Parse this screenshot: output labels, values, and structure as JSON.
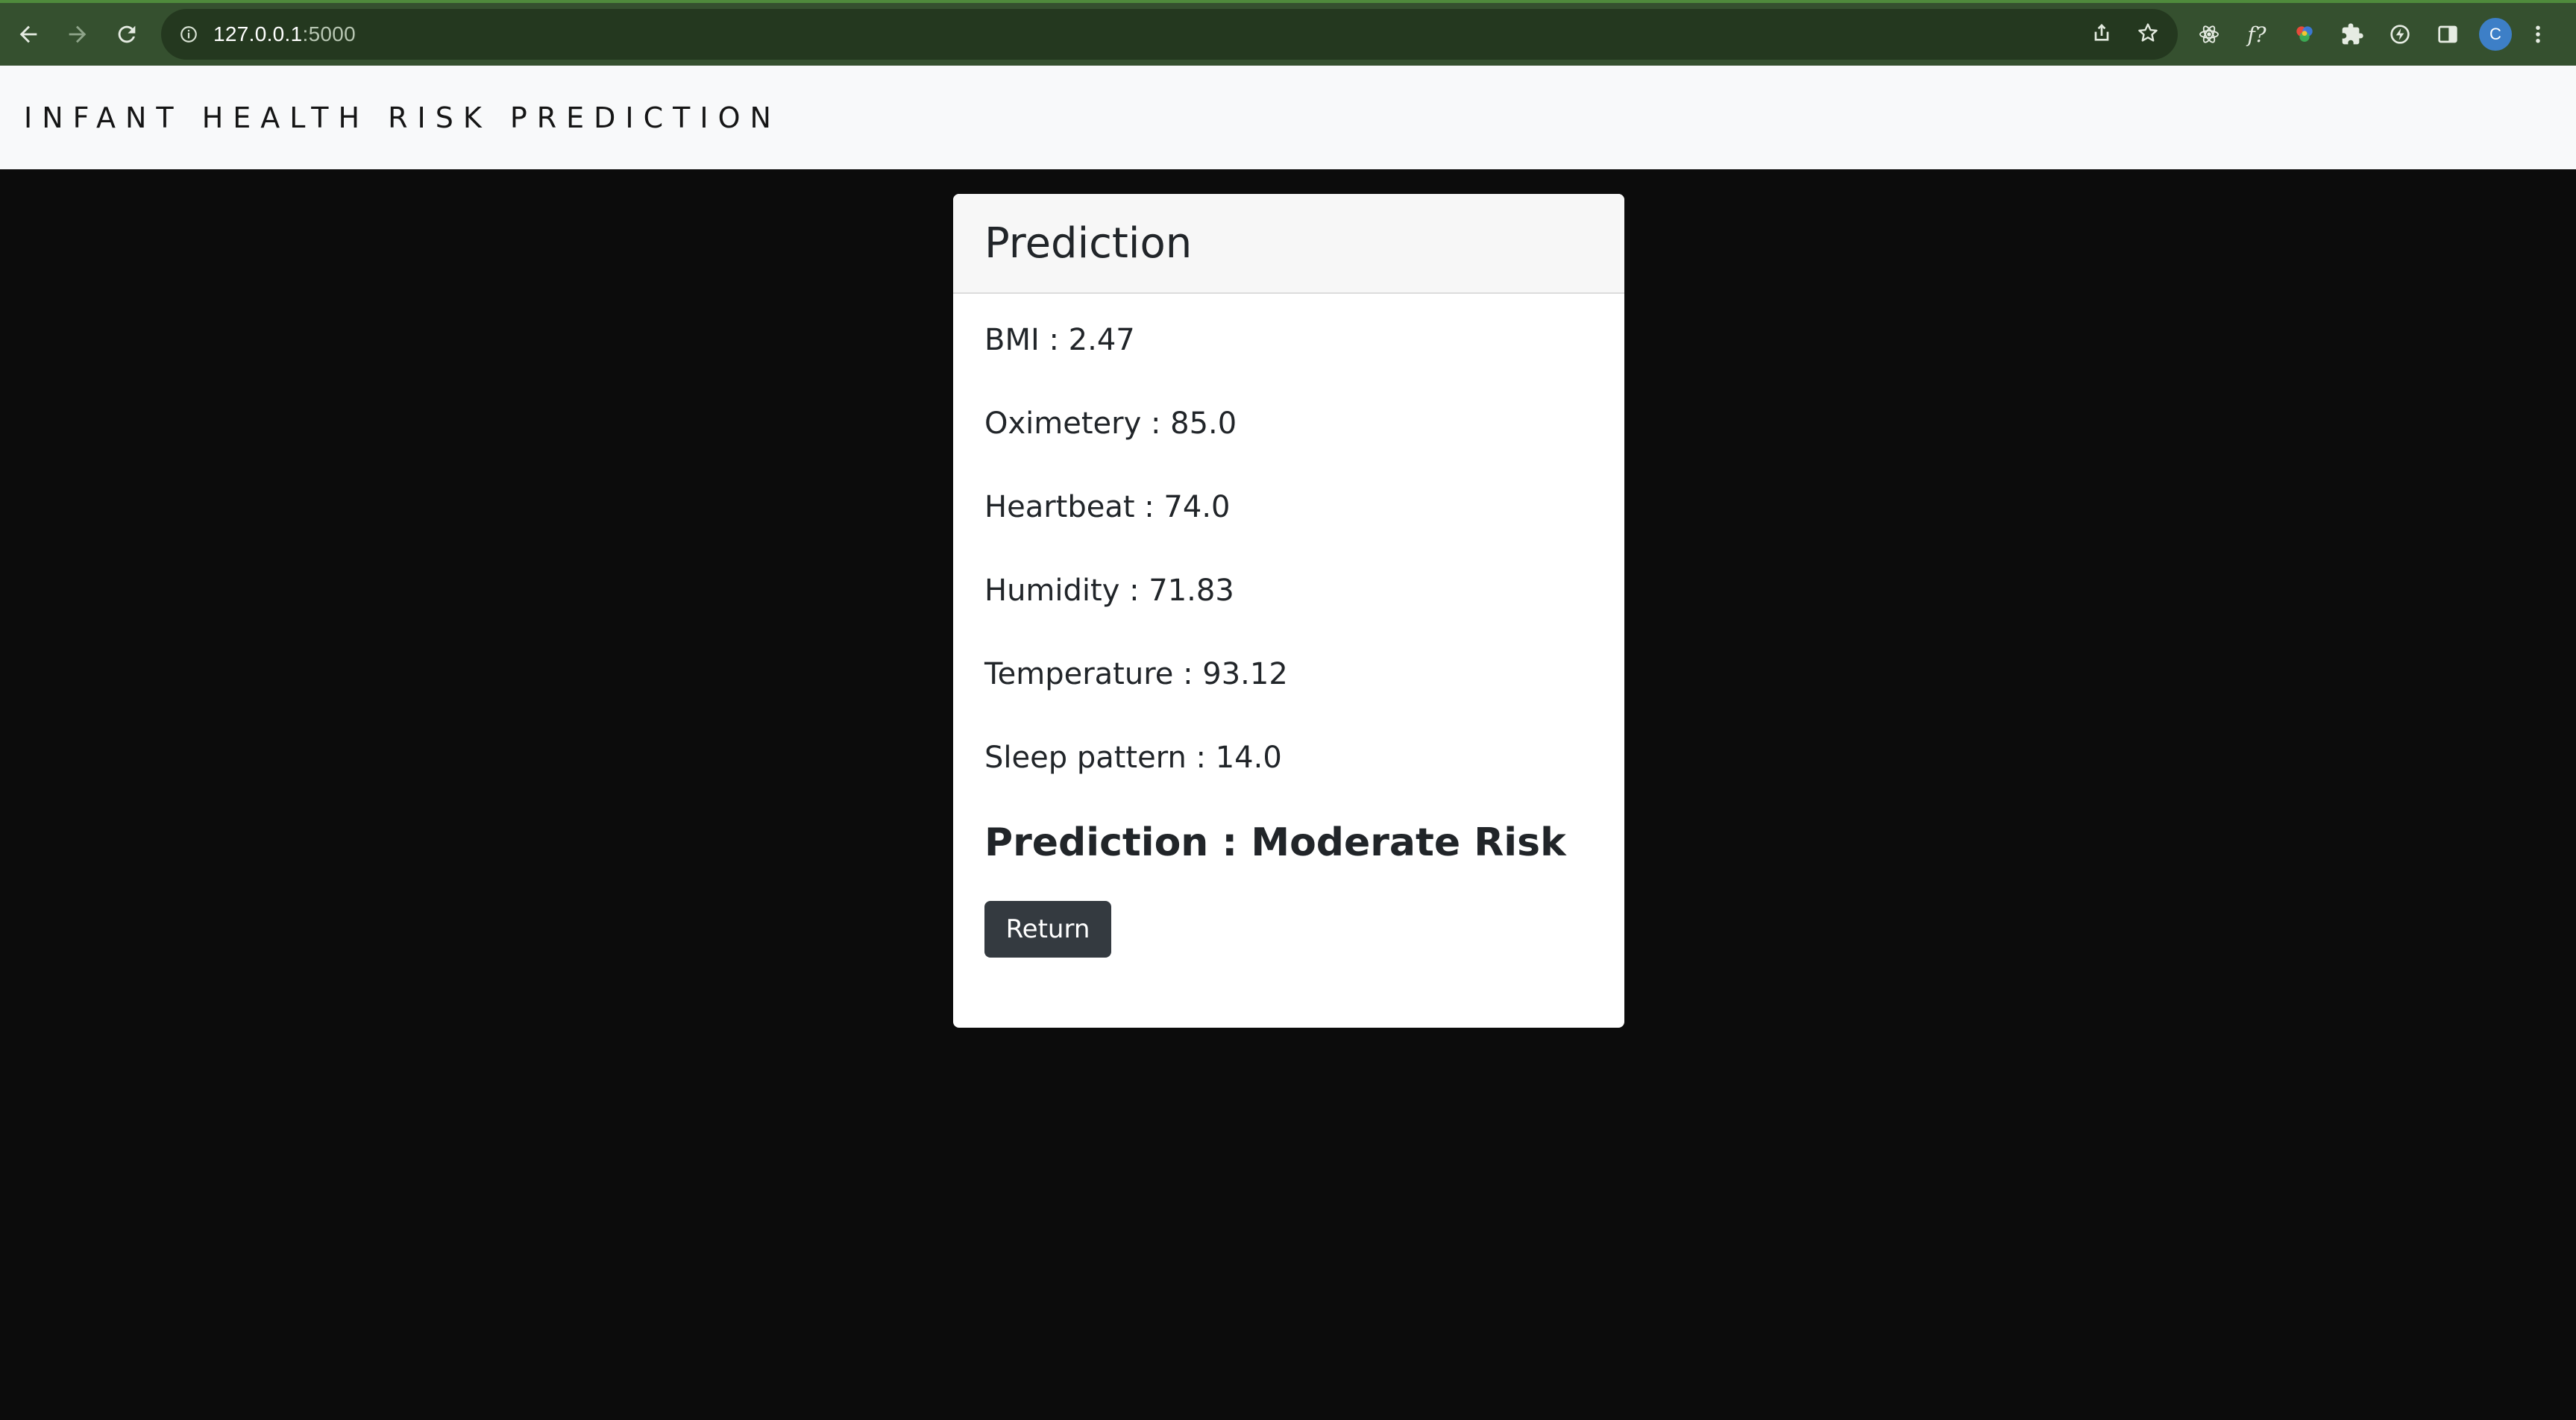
{
  "browser": {
    "url_host": "127.0.0.1",
    "url_port": ":5000",
    "avatar_letter": "C",
    "extension_formula_label": "f?"
  },
  "navbar": {
    "brand": "INFANT HEALTH RISK PREDICTION"
  },
  "card": {
    "title": "Prediction",
    "fields": {
      "bmi": "BMI : 2.47",
      "oximetery": "Oximetery : 85.0",
      "heartbeat": "Heartbeat : 74.0",
      "humidity": "Humidity : 71.83",
      "temperature": "Temperature : 93.12",
      "sleep_pattern": "Sleep pattern : 14.0"
    },
    "prediction": "Prediction : Moderate Risk",
    "return_label": "Return"
  },
  "colors": {
    "chrome_bg": "#35502f",
    "navbar_bg": "#f8f9fa",
    "page_bg": "#0c0c0c",
    "button_bg": "#343a40"
  }
}
